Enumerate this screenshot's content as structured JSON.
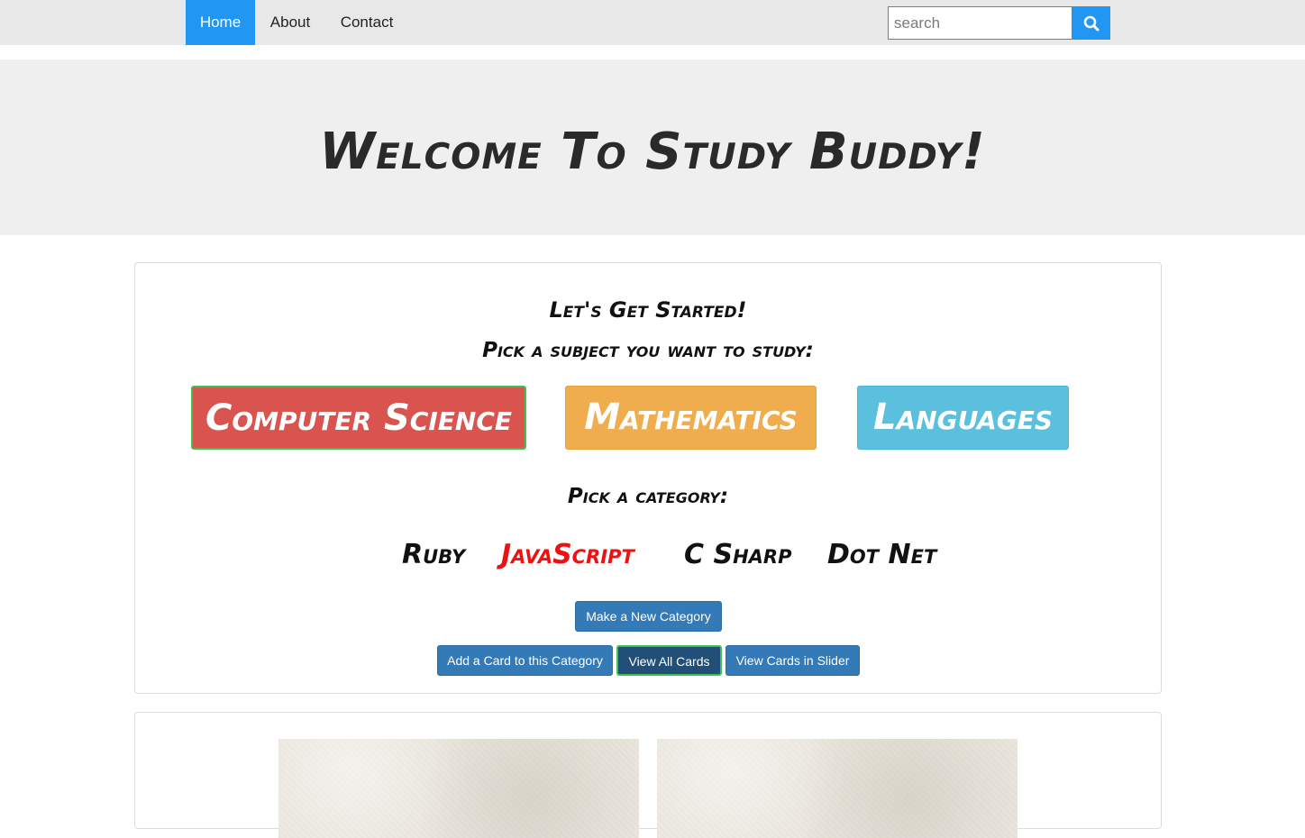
{
  "nav": {
    "home": "Home",
    "about": "About",
    "contact": "Contact"
  },
  "search": {
    "placeholder": "search",
    "icon": "search-icon"
  },
  "hero": {
    "title": "Welcome To Study Buddy!"
  },
  "main": {
    "started": "Let's Get Started!",
    "subject_prompt": "Pick a subject you want to study:",
    "subjects": [
      "Computer Science",
      "Mathematics",
      "Languages"
    ],
    "category_prompt": "Pick a category:",
    "categories": [
      "Ruby",
      "JavaScript",
      "C Sharp",
      "Dot Net"
    ],
    "new_category": "Make a New Category",
    "add_card": "Add a Card to this Category",
    "view_all": "View All Cards",
    "view_slider": "View Cards in Slider"
  },
  "colors": {
    "nav_active": "#2196f3",
    "cs": "#d9534f",
    "math": "#f0ad4e",
    "languages": "#5bc0de",
    "selected_category": "#ee1111",
    "action_button": "#337ab7"
  }
}
